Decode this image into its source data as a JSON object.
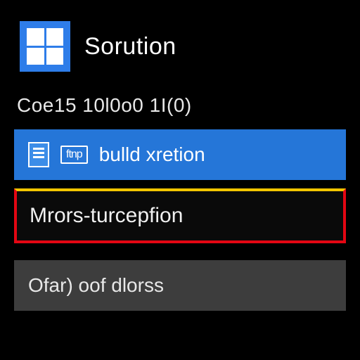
{
  "header": {
    "title": "Sorution"
  },
  "subtitle": "Coe15 10l0o0 1I(0)",
  "items": [
    {
      "badge": "ftnp",
      "label": "bulld xretion"
    },
    {
      "label": "Mrors-turcepfion"
    },
    {
      "label": "Ofar) oof dlorss"
    }
  ]
}
